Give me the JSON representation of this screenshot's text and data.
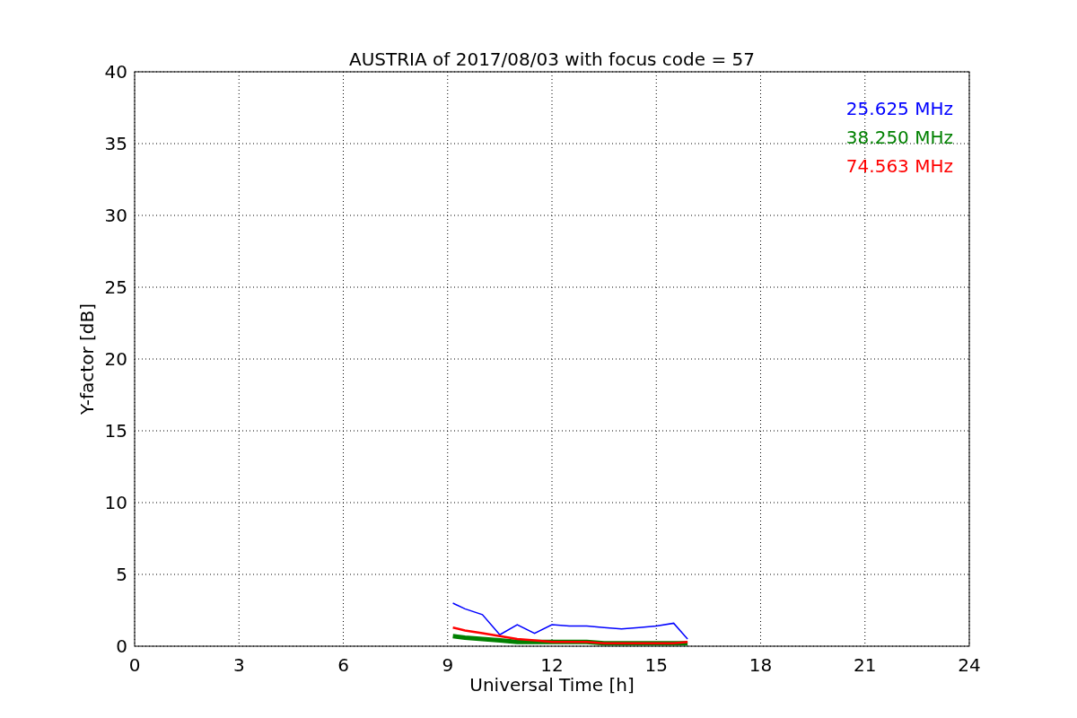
{
  "chart_data": {
    "type": "line",
    "grid": true,
    "title": "AUSTRIA of 2017/08/03 with focus code = 57",
    "xlabel": "Universal Time [h]",
    "ylabel": "Y-factor [dB]",
    "xlim": [
      0,
      24
    ],
    "ylim": [
      0,
      40
    ],
    "xticks": [
      0,
      3,
      6,
      9,
      12,
      15,
      18,
      21,
      24
    ],
    "yticks": [
      0,
      5,
      10,
      15,
      20,
      25,
      30,
      35,
      40
    ],
    "x": [
      9.15,
      9.5,
      10,
      10.5,
      11,
      11.5,
      12,
      12.5,
      13,
      13.5,
      14,
      14.5,
      15,
      15.5,
      15.9
    ],
    "series": [
      {
        "name": "25.625 MHz",
        "color": "#0000ff",
        "values": [
          3.0,
          2.6,
          2.2,
          0.8,
          1.5,
          0.9,
          1.5,
          1.4,
          1.4,
          1.3,
          1.2,
          1.3,
          1.4,
          1.6,
          0.5
        ]
      },
      {
        "name": "38.250 MHz",
        "color": "#008000",
        "values": [
          0.7,
          0.6,
          0.5,
          0.4,
          0.3,
          0.3,
          0.3,
          0.3,
          0.3,
          0.2,
          0.2,
          0.2,
          0.2,
          0.2,
          0.2
        ]
      },
      {
        "name": "74.563 MHz",
        "color": "#ff0000",
        "values": [
          1.3,
          1.1,
          0.9,
          0.7,
          0.5,
          0.4,
          0.3,
          0.3,
          0.3,
          0.2,
          0.2,
          0.2,
          0.2,
          0.2,
          0.3
        ]
      }
    ]
  }
}
